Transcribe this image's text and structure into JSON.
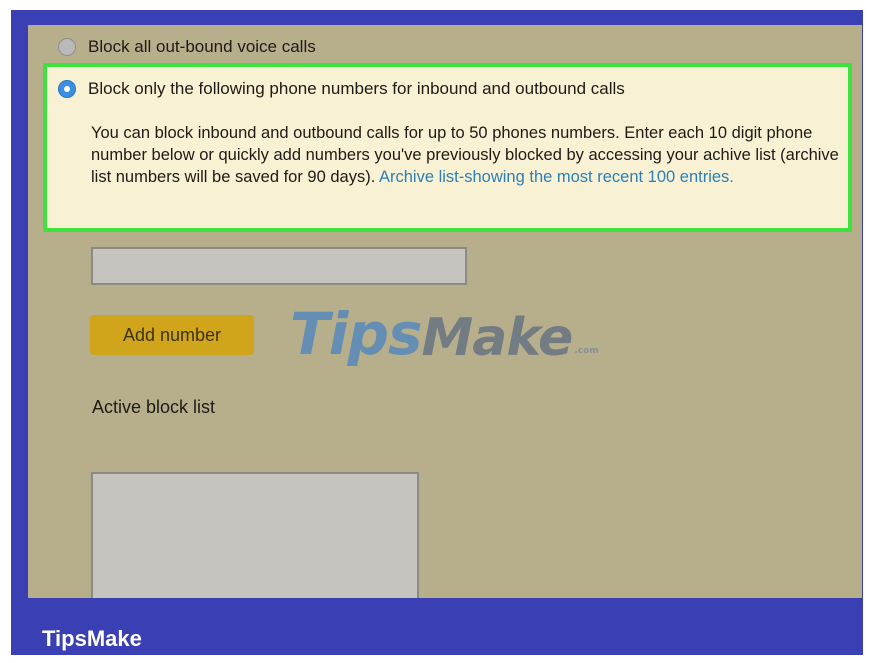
{
  "options": {
    "block_outbound_voice": {
      "label": "Block all out-bound voice calls",
      "selected": false
    },
    "block_following": {
      "label": "Block only the following phone numbers for inbound and outbound calls",
      "selected": true
    }
  },
  "description": {
    "text": "You can block inbound and outbound calls for up to 50 phones numbers. Enter each 10 digit phone number below or quickly add numbers you've previously blocked by accessing your achive list (archive list numbers will be saved for 90 days).",
    "link": "Archive list-showing the most recent 100 entries."
  },
  "phone_input": {
    "value": "",
    "placeholder": ""
  },
  "add_button": {
    "label": "Add number"
  },
  "active_block_list": {
    "heading": "Active block list"
  },
  "watermark": {
    "tips": "Tips",
    "make": "Make",
    "com": ".com"
  },
  "brand": {
    "label": "TipsMake"
  },
  "colors": {
    "frame": "#3a3fb4",
    "panel": "#b7ae8c",
    "highlight_border": "#3ee23e",
    "highlight_bg": "#f8f1d4",
    "radio_selected": "#3b8ee0",
    "button": "#d0a51c",
    "link": "#2b80b8"
  }
}
